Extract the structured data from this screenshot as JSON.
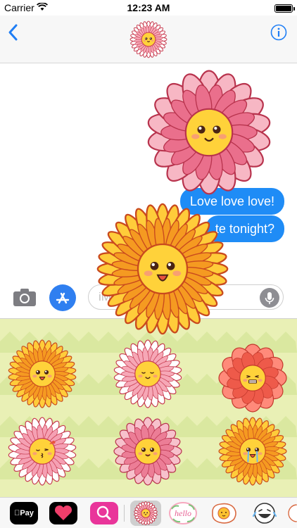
{
  "status_bar": {
    "carrier": "Carrier",
    "time": "12:23 AM",
    "battery_level": 1.0
  },
  "nav": {
    "back_icon": "chevron-left-icon",
    "info_icon": "info-icon",
    "avatar": "flower-sticker-avatar"
  },
  "messages": [
    {
      "text": "Love love love!",
      "sender": "me"
    },
    {
      "text": "te tonight?",
      "sender": "me"
    }
  ],
  "input": {
    "placeholder": "iMessage",
    "camera_icon": "camera-icon",
    "apps_icon": "app-store-icon",
    "mic_icon": "microphone-icon"
  },
  "app_strip": {
    "apple_pay_label": "Pay",
    "hello_sticker_text": "hello",
    "apps": [
      "apple-pay-icon",
      "heart-app-icon",
      "search-globe-icon"
    ]
  },
  "colors": {
    "bubble": "#1f8cf6",
    "accent": "#2f7ff0",
    "drawer_bg": "#e9f0b5",
    "drawer_wave": "#d4e69a"
  }
}
